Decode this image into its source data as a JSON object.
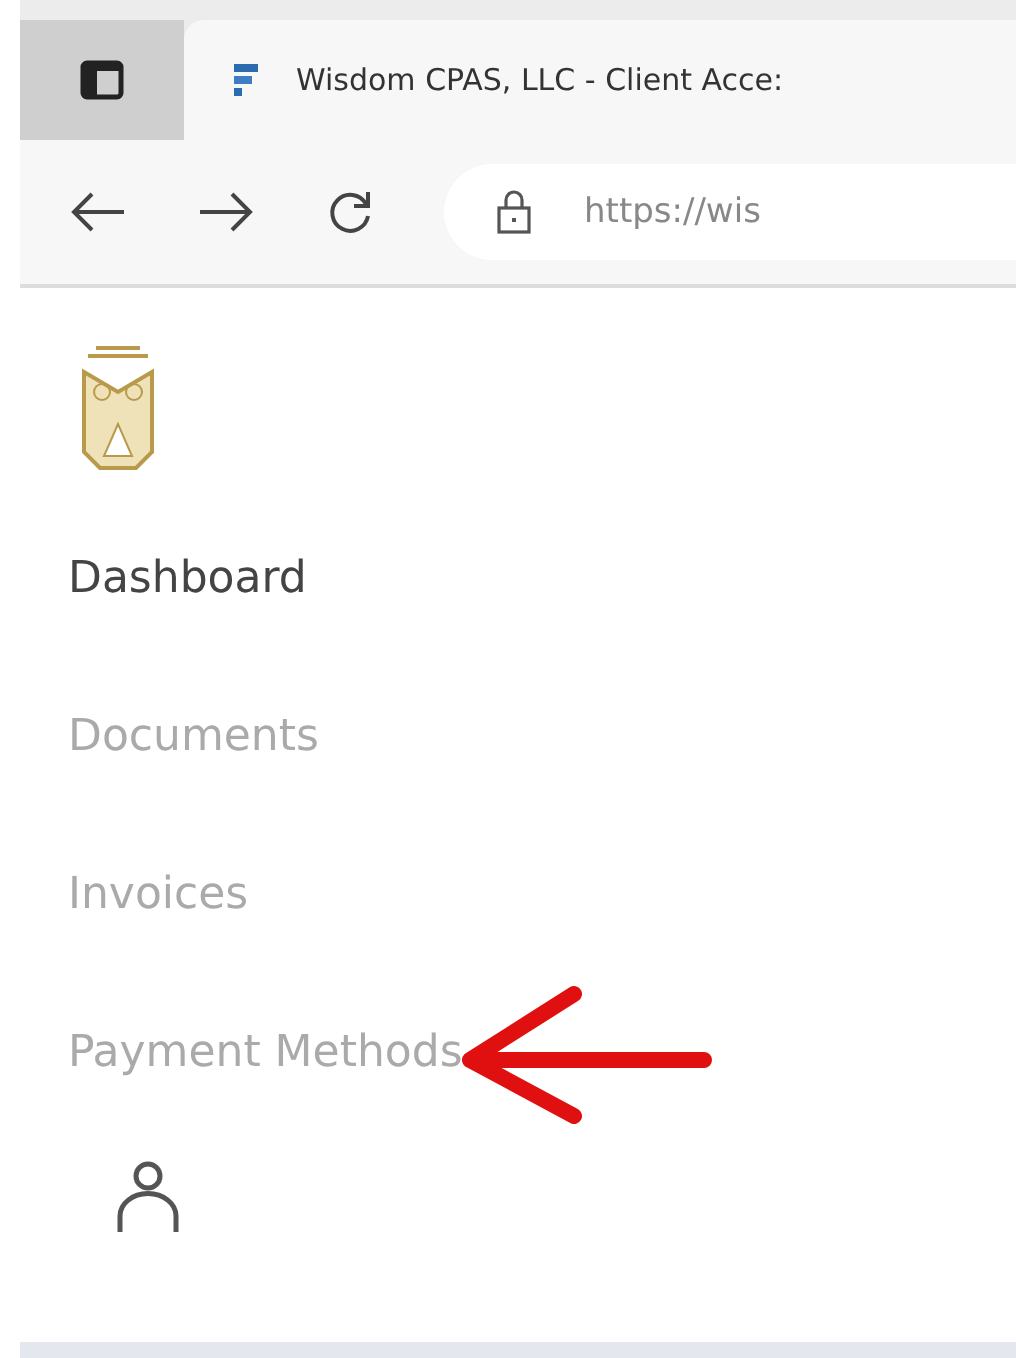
{
  "browser": {
    "tab_title": "Wisdom CPAS, LLC - Client Acce:",
    "url": "https://wis"
  },
  "nav": [
    {
      "label": "Dashboard",
      "selected": true
    },
    {
      "label": "Documents",
      "selected": false
    },
    {
      "label": "Invoices",
      "selected": false
    },
    {
      "label": "Payment Methods",
      "selected": false,
      "annotated": true
    }
  ]
}
